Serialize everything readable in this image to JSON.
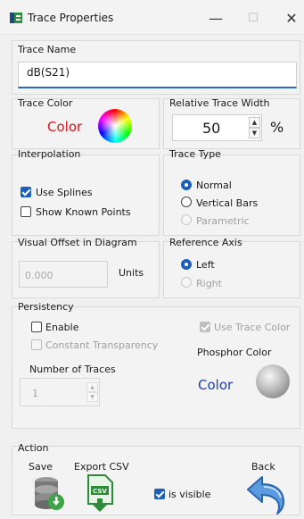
{
  "window": {
    "title": "Trace Properties",
    "minimize": "—",
    "maximize": "☐",
    "close": "✕"
  },
  "trace_name": {
    "label": "Trace Name",
    "value": "dB(S21)"
  },
  "trace_color": {
    "label": "Trace Color",
    "text": "Color",
    "text_color": "#d9151b"
  },
  "width": {
    "label": "Relative Trace Width",
    "value": "50",
    "unit": "%"
  },
  "interpolation": {
    "label": "Interpolation",
    "use_splines": "Use Splines",
    "use_splines_checked": true,
    "show_known": "Show Known Points",
    "show_known_checked": false
  },
  "trace_type": {
    "label": "Trace Type",
    "options": [
      "Normal",
      "Vertical Bars",
      "Parametric"
    ],
    "selected": "Normal"
  },
  "offset": {
    "label": "Visual Offset in Diagram",
    "value": "0.000",
    "unit": "Units"
  },
  "ref_axis": {
    "label": "Reference Axis",
    "options": [
      "Left",
      "Right"
    ],
    "selected": "Left"
  },
  "persistency": {
    "label": "Persistency",
    "enable": "Enable",
    "enable_checked": false,
    "constant_transparency": "Constant Transparency",
    "use_trace_color": "Use Trace Color",
    "use_trace_color_checked": true,
    "phosphor_label": "Phosphor Color",
    "phosphor_text": "Color",
    "phosphor_text_color": "#1a3fc4",
    "num_traces_label": "Number of Traces",
    "num_traces_value": "1"
  },
  "action": {
    "label": "Action",
    "save": "Save",
    "export": "Export CSV",
    "export_icon_text": "CSV",
    "is_visible": "is visible",
    "is_visible_checked": true,
    "back": "Back"
  }
}
